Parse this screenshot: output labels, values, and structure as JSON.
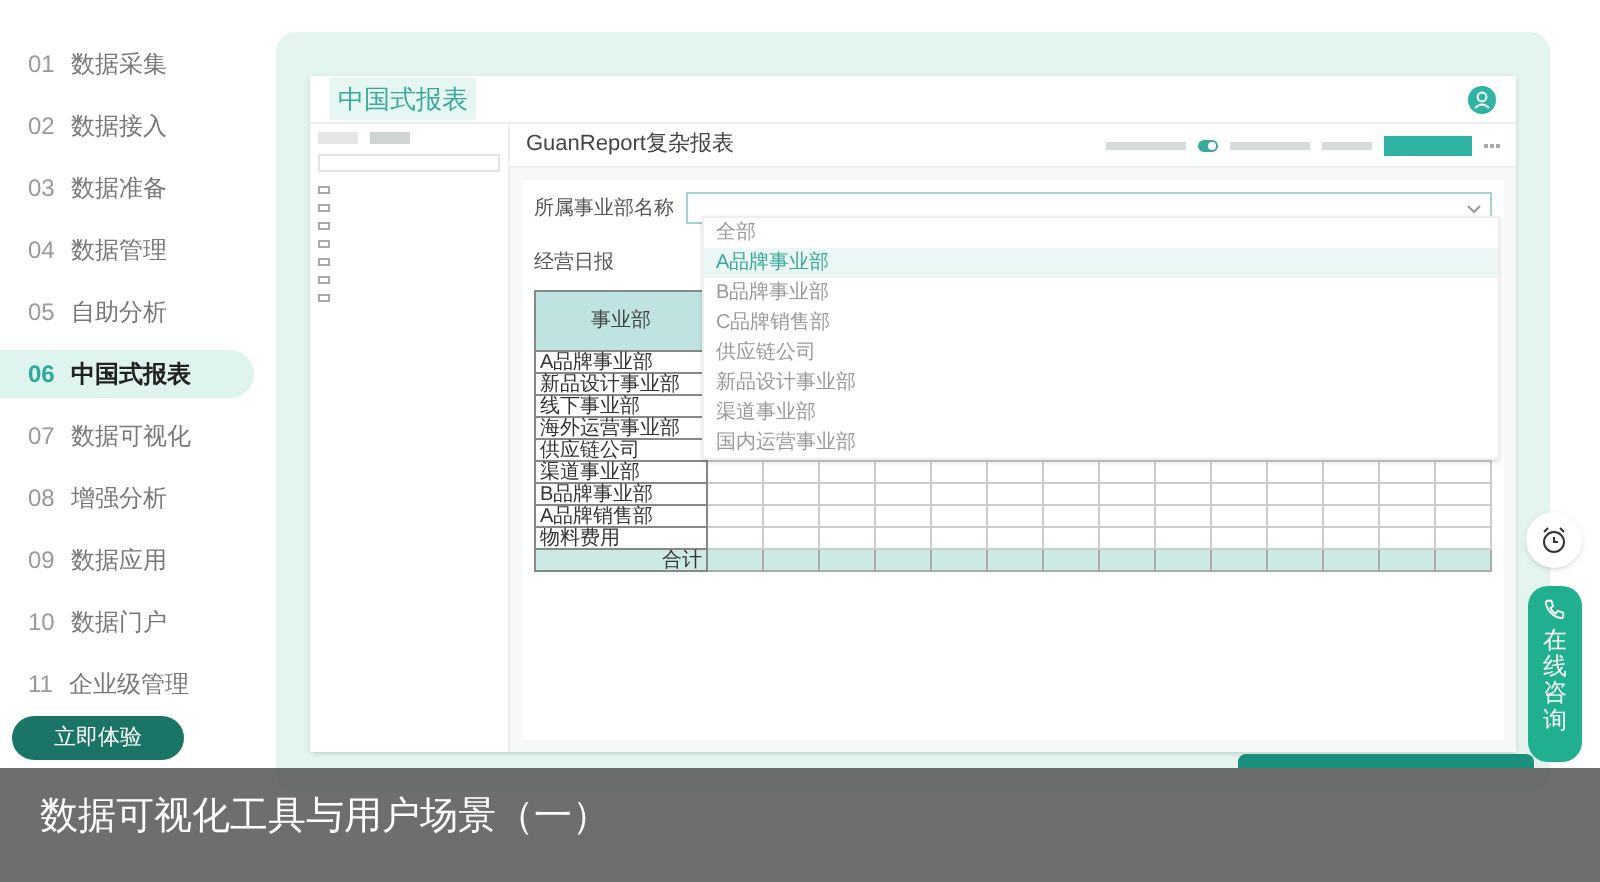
{
  "nav": {
    "items": [
      {
        "num": "01",
        "label": "数据采集",
        "selected": false
      },
      {
        "num": "02",
        "label": "数据接入",
        "selected": false
      },
      {
        "num": "03",
        "label": "数据准备",
        "selected": false
      },
      {
        "num": "04",
        "label": "数据管理",
        "selected": false
      },
      {
        "num": "05",
        "label": "自助分析",
        "selected": false
      },
      {
        "num": "06",
        "label": "中国式报表",
        "selected": true
      },
      {
        "num": "07",
        "label": "数据可视化",
        "selected": false
      },
      {
        "num": "08",
        "label": "增强分析",
        "selected": false
      },
      {
        "num": "09",
        "label": "数据应用",
        "selected": false
      },
      {
        "num": "10",
        "label": "数据门户",
        "selected": false
      },
      {
        "num": "11",
        "label": "企业级管理",
        "selected": false
      }
    ],
    "cta": "立即体验"
  },
  "app": {
    "title": "中国式报表",
    "report_title": "GuanReport复杂报表",
    "toggle": {
      "on": true
    },
    "filter": {
      "label": "所属事业部名称"
    },
    "dropdown": [
      {
        "label": "全部",
        "selected": false
      },
      {
        "label": "A品牌事业部",
        "selected": true
      },
      {
        "label": "B品牌事业部",
        "selected": false
      },
      {
        "label": "C品牌销售部",
        "selected": false
      },
      {
        "label": "供应链公司",
        "selected": false
      },
      {
        "label": "新品设计事业部",
        "selected": false
      },
      {
        "label": "渠道事业部",
        "selected": false
      },
      {
        "label": "国内运营事业部",
        "selected": false
      }
    ],
    "report": {
      "heading": "经营日报",
      "column_header": "事业部",
      "rows": [
        "A品牌事业部",
        "新品设计事业部",
        "线下事业部",
        "海外运营事业部",
        "供应链公司",
        "渠道事业部",
        "B品牌事业部",
        "A品牌销售部",
        "物料费用"
      ],
      "total": "合计"
    }
  },
  "chat": {
    "label": "在线咨询"
  },
  "caption": "数据可视化工具与用户场景（一）"
}
